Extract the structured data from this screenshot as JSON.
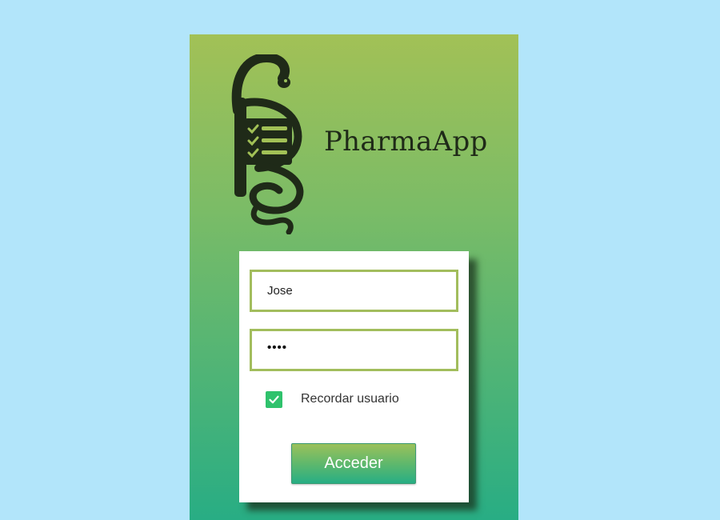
{
  "app": {
    "name": "PharmaApp",
    "logo_icon": "caduceus-snake-checklist-icon"
  },
  "login": {
    "username_value": "Jose",
    "password_mask": "••••",
    "remember_label": "Recordar usuario",
    "remember_checked": true,
    "submit_label": "Acceder"
  },
  "colors": {
    "page_background": "#b2e5fa",
    "gradient_top": "#a2c156",
    "gradient_bottom": "#28ad84",
    "field_border": "#a2bd5d",
    "checkbox": "#2fc26c",
    "logo_dark": "#1f2a18"
  }
}
